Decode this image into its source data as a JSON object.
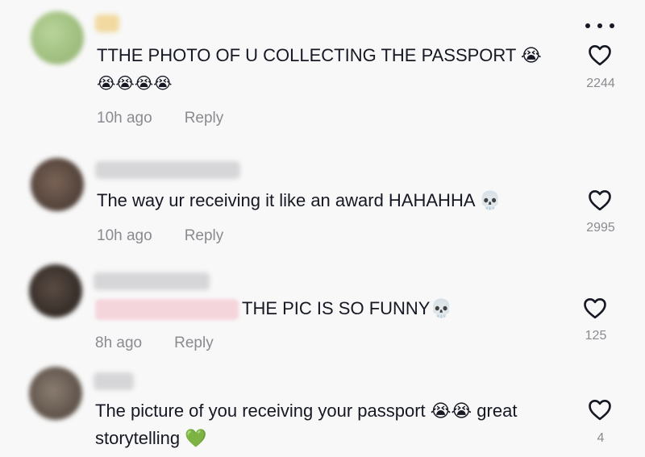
{
  "comments": [
    {
      "text_line1": "TTHE PHOTO OF U COLLECTING THE PASSPORT 😭",
      "text_line2": "😭😭😭😭",
      "time": "10h ago",
      "reply": "Reply",
      "likes": "2244"
    },
    {
      "text_line1": "The way ur receiving it like an award HAHAHHA 💀",
      "time": "10h ago",
      "reply": "Reply",
      "likes": "2995"
    },
    {
      "text_line1": "THE PIC IS SO FUNNY💀",
      "time": "8h ago",
      "reply": "Reply",
      "likes": "125"
    },
    {
      "text_line1": "The picture of you receiving your passport 😭😭 great",
      "text_line2": "storytelling 💚",
      "time": "",
      "reply": "",
      "likes": "4"
    }
  ],
  "icons": {
    "more": "more-options-icon",
    "like": "heart-outline-icon"
  },
  "colors": {
    "background": "#f8f8f8",
    "text": "#161823",
    "secondary": "#8a8b91"
  }
}
